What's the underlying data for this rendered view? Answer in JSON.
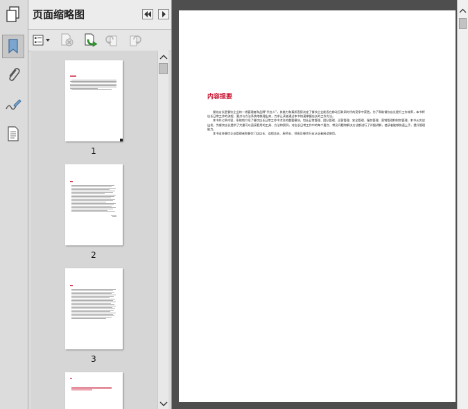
{
  "panel": {
    "title": "页面缩略图"
  },
  "thumbnails": [
    {
      "page": "1"
    },
    {
      "page": "2"
    },
    {
      "page": "3"
    }
  ],
  "document": {
    "heading": "内容提要",
    "paragraphs": [
      "餐饮店长是餐饮企业的一线管理者和品牌“代言人”，其能力和素质直接决定了餐饮企业能否在移动互联网时代的竞争中获胜。为了帮助餐饮店长提升工作效率，本书将店长日常工作的流程、要点与方法系统地梳理出来，力求让读者通过本书快速掌握店长的工作方法。",
      "本书共七章内容，系统地介绍了餐饮店长日常工作中涉及的重要模块，包括日常管理、团队管理、运营管理、安全管理、服务管理、营销管理和财务管理。本书从实战出发，为餐饮店长提供了大量可以直接套用的工具、方法和案例，对店长日常工作中的每个要点、常见问题和解决方法都进行了详细讲解，使读者能够快速上手，提升管理能力。",
      "本书适合餐饮企业管理者和餐饮门店店长、连锁店长、厨师长、领班及餐饮行业从业者阅读使用。"
    ]
  }
}
